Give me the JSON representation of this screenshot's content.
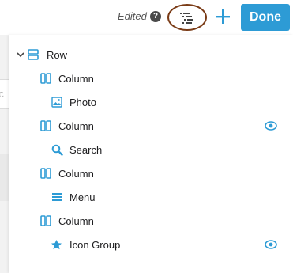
{
  "toolbar": {
    "status_text": "Edited",
    "help_icon_glyph": "?",
    "done_label": "Done"
  },
  "background": {
    "partial_text": "rc"
  },
  "outline": {
    "items": [
      {
        "label": "Row",
        "icon": "row-icon",
        "level": 0,
        "expanded": true
      },
      {
        "label": "Column",
        "icon": "column-icon",
        "level": 1
      },
      {
        "label": "Photo",
        "icon": "photo-icon",
        "level": 2
      },
      {
        "label": "Column",
        "icon": "column-icon",
        "level": 1,
        "visibility": "eye-icon"
      },
      {
        "label": "Search",
        "icon": "search-icon",
        "level": 2
      },
      {
        "label": "Column",
        "icon": "column-icon",
        "level": 1
      },
      {
        "label": "Menu",
        "icon": "menu-icon",
        "level": 2
      },
      {
        "label": "Column",
        "icon": "column-icon",
        "level": 1
      },
      {
        "label": "Icon Group",
        "icon": "star-icon",
        "level": 2,
        "visibility": "eye-icon"
      }
    ]
  },
  "colors": {
    "accent": "#2d9bd5",
    "highlight_ring": "#7a3b16"
  }
}
